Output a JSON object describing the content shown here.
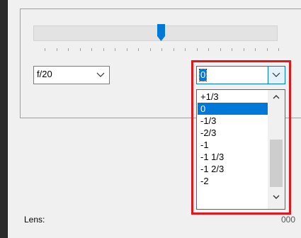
{
  "aperture": {
    "value": "f/20"
  },
  "exposure": {
    "value": "0",
    "options": [
      "+1/3",
      "0",
      "-1/3",
      "-2/3",
      "-1",
      "-1 1/3",
      "-1 2/3",
      "-2"
    ],
    "selected_index": 1
  },
  "lens": {
    "label": "Lens:",
    "value": "000"
  },
  "slider": {
    "level": 0.5,
    "tick_count": 21
  },
  "colors": {
    "highlight": "#e0181c",
    "accent": "#0078d7",
    "slider_thumb": "#0078d7"
  }
}
